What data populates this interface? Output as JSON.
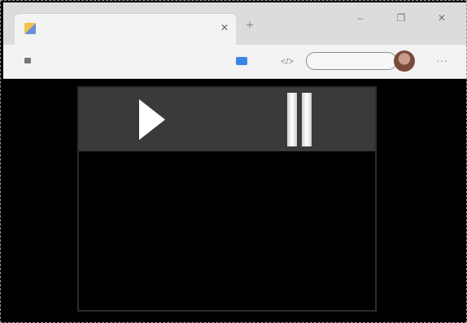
{
  "browser": {
    "tab": {
      "title": "",
      "favicon": "page-favicon-icon",
      "close_icon": "close-icon"
    },
    "new_tab_icon": "plus-icon",
    "window_controls": {
      "minimize_icon": "minimize-icon",
      "maximize_icon": "maximize-icon",
      "close_icon": "close-icon"
    },
    "address_bar": {
      "security_icon": "lock-icon",
      "url": ""
    },
    "toolbar": {
      "extension_icon": "extension-icon",
      "reader_icon": "reader-mode-icon",
      "status_pill": "",
      "profile": "avatar",
      "menu_icon": "more-dots-icon"
    }
  },
  "player": {
    "play_icon": "play-icon",
    "pause_icon": "pause-icon",
    "colors": {
      "controls_bg": "#3a3a3a",
      "page_bg": "#000000",
      "icon": "#ffffff"
    }
  }
}
